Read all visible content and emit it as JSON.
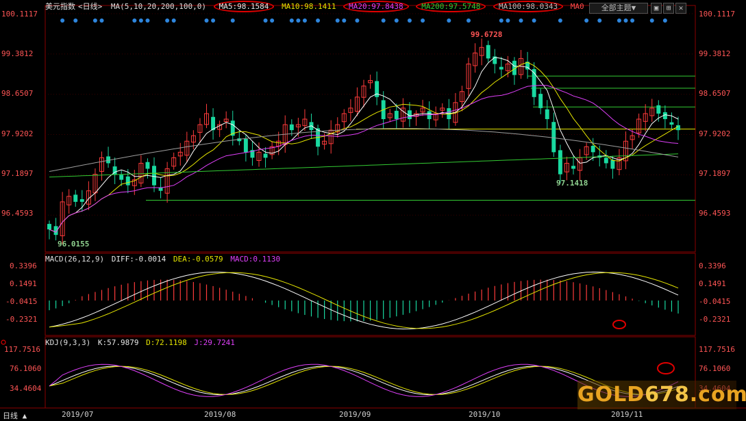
{
  "title_row": {
    "name": "美元指数",
    "period": "<日线>",
    "ma_label": "MA(5,10,20,200,100,0)",
    "ma5": "MA5:98.1584",
    "ma10": "MA10:98.1411",
    "ma20": "MA20:97.8438",
    "ma200": "MA200:97.5748",
    "ma100": "MA100:98.0343",
    "ma0": "MA0"
  },
  "toolbar": {
    "theme": "全部主题▼",
    "period_button": "日线 ▲"
  },
  "macd_row": {
    "label": "MACD(26,12,9)",
    "diff": "DIFF:-0.0014",
    "dea": "DEA:-0.0579",
    "macd": "MACD:0.1130"
  },
  "kdj_row": {
    "label": "KDJ(9,3,3)",
    "k": "K:57.9879",
    "d": "D:72.1198",
    "j": "J:29.7241"
  },
  "price_axis": [
    "100.1117",
    "99.3812",
    "98.6507",
    "97.9202",
    "97.1897",
    "96.4593"
  ],
  "macd_axis": [
    "0.3396",
    "0.1491",
    "-0.0415",
    "-0.2321"
  ],
  "kdj_axis": [
    "117.7516",
    "76.1060",
    "34.4604"
  ],
  "x_axis": [
    "2019/07",
    "2019/08",
    "2019/09",
    "2019/10",
    "2019/11"
  ],
  "annotations": {
    "high": "99.6728",
    "low1": "96.0155",
    "low2": "97.1418"
  },
  "watermark": {
    "part1": "GOLD",
    "part2": "678",
    "part3": ".com"
  },
  "colors": {
    "up": "#ff3b3b",
    "down": "#19d9a0",
    "ma5": "#ffffff",
    "ma10": "#e6e600",
    "ma20": "#e040fb",
    "ma200": "#33cc33",
    "ma100": "#9e9e9e",
    "accent": "#e00000"
  },
  "chart_data": {
    "type": "line",
    "title": "美元指数<日线>",
    "ylim": [
      96.0155,
      100.1117
    ],
    "x_ticks": [
      "2019/07",
      "2019/08",
      "2019/09",
      "2019/10",
      "2019/11"
    ],
    "series": [
      {
        "name": "MA5",
        "last": 98.1584
      },
      {
        "name": "MA10",
        "last": 98.1411
      },
      {
        "name": "MA20",
        "last": 97.8438
      },
      {
        "name": "MA200",
        "last": 97.5748
      },
      {
        "name": "MA100",
        "last": 98.0343
      }
    ],
    "close": [
      96.2,
      96.1,
      96.7,
      96.8,
      96.7,
      96.7,
      96.9,
      97.2,
      97.5,
      97.4,
      97.2,
      97.1,
      97.0,
      97.1,
      97.4,
      97.3,
      97.0,
      96.9,
      97.3,
      97.5,
      97.6,
      97.8,
      97.9,
      98.1,
      98.3,
      98.0,
      98.1,
      98.2,
      97.9,
      97.8,
      97.6,
      97.5,
      97.6,
      97.5,
      97.7,
      97.8,
      98.1,
      98.0,
      98.1,
      98.2,
      98.0,
      97.7,
      97.8,
      98.0,
      98.1,
      98.3,
      98.4,
      98.6,
      98.8,
      98.9,
      98.6,
      98.2,
      98.3,
      98.2,
      98.4,
      98.2,
      98.3,
      98.4,
      98.2,
      98.3,
      98.4,
      98.2,
      98.5,
      98.7,
      99.2,
      99.4,
      99.5,
      99.3,
      99.2,
      99.1,
      99.2,
      99.0,
      99.3,
      99.1,
      98.6,
      98.4,
      98.2,
      97.6,
      97.2,
      97.4,
      97.3,
      97.5,
      97.7,
      97.6,
      97.5,
      97.4,
      97.3,
      97.5,
      97.8,
      97.9,
      98.2,
      98.3,
      98.4,
      98.3,
      98.2,
      98.1,
      98.0
    ]
  }
}
